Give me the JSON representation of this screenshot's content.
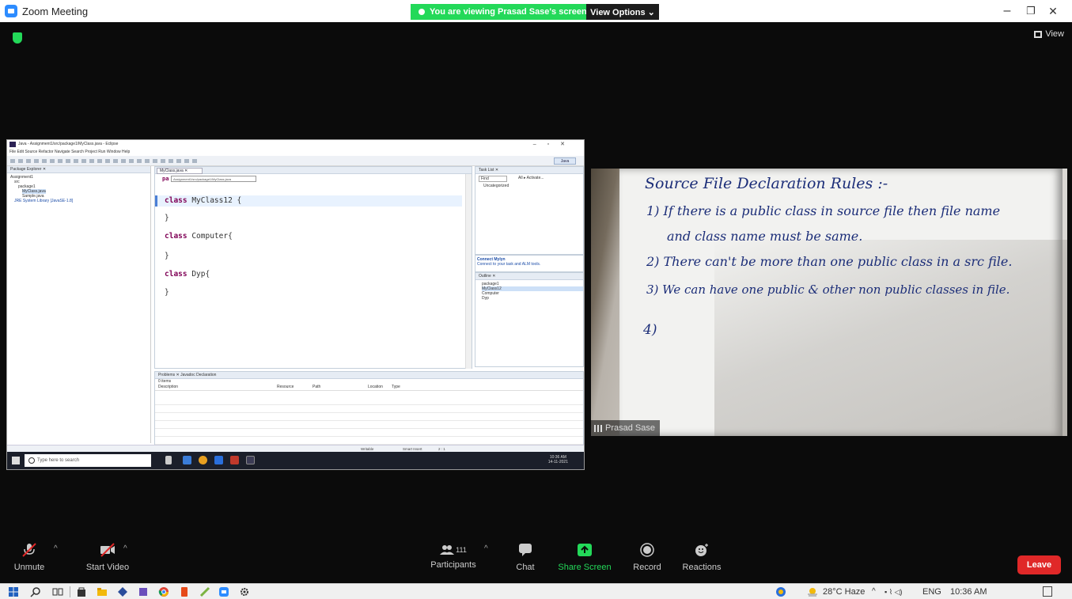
{
  "window": {
    "title": "Zoom Meeting",
    "minimize": "–",
    "maximize": "❐",
    "close": "✕"
  },
  "banner": {
    "viewing": "You are viewing Prasad Sase's screen",
    "view_options": "View Options ⌄"
  },
  "view_button": "View",
  "shared_screen": {
    "title": "Java - Assignment1/src/package1/MyClass.java - Eclipse",
    "menu": "File  Edit  Source  Refactor  Navigate  Search  Project  Run  Window  Help",
    "perspective": "Java",
    "package_explorer": {
      "title": "Package Explorer ✕",
      "tree": [
        "Assignment1",
        "src",
        "package1",
        "MyClass.java",
        "Sample.java",
        "JRE System Library [JavaSE-1.8]"
      ]
    },
    "editor": {
      "tab": "MyClass.java ✕",
      "hint": "Assignment1/src/package1/MyClass.java",
      "hint_prefix": "pa",
      "kw": "class",
      "lines": [
        {
          "kw": "class",
          "rest": " MyClass12 {"
        },
        {
          "kw": "",
          "rest": "}"
        },
        {
          "kw": "class",
          "rest": " Computer{"
        },
        {
          "kw": "",
          "rest": "}"
        },
        {
          "kw": "class",
          "rest": " Dyp{"
        },
        {
          "kw": "",
          "rest": "}"
        }
      ]
    },
    "task_list": {
      "title": "Task List ✕",
      "find": "Find",
      "all": "All  ▸ Activate...",
      "uncat": "Uncategorized"
    },
    "connect": {
      "title": "Connect Mylyn",
      "text": "Connect to your task and ALM tools."
    },
    "outline": {
      "title": "Outline ✕",
      "items": [
        "package1",
        "MyClass12",
        "Computer",
        "Dyp"
      ]
    },
    "problems": {
      "tabs": "Problems ✕   Javadoc   Declaration",
      "count": "0 items",
      "columns": [
        "Description",
        "Resource",
        "Path",
        "Location",
        "Type"
      ]
    },
    "status": {
      "writable": "Writable",
      "insert": "Smart Insert",
      "pos": "2 : 1"
    },
    "taskbar": {
      "search": "Type here to search",
      "time": "10:36 AM",
      "date": "14-11-2021"
    }
  },
  "video": {
    "participant": "Prasad Sase",
    "notes": {
      "title": "Source File Declaration Rules :-",
      "line1": "1)  If there is a public class in source file then file name",
      "line1b": "and class name must be same.",
      "line2": "2)  There can't be more than one public class in a src file.",
      "line3": "3)  We can have one public & other non public classes in file.",
      "line4": "4)"
    }
  },
  "controls": {
    "unmute": "Unmute",
    "start_video": "Start Video",
    "participants": "Participants",
    "participant_count": "111",
    "chat": "Chat",
    "share_screen": "Share Screen",
    "record": "Record",
    "reactions": "Reactions",
    "leave": "Leave"
  },
  "taskbar": {
    "weather": "28°C Haze",
    "lang": "ENG",
    "time": "10:36 AM"
  },
  "colors": {
    "zoom_green": "#23d959",
    "leave_red": "#e02828",
    "zoom_blue": "#2d8cff",
    "ink": "#1b2d78"
  }
}
